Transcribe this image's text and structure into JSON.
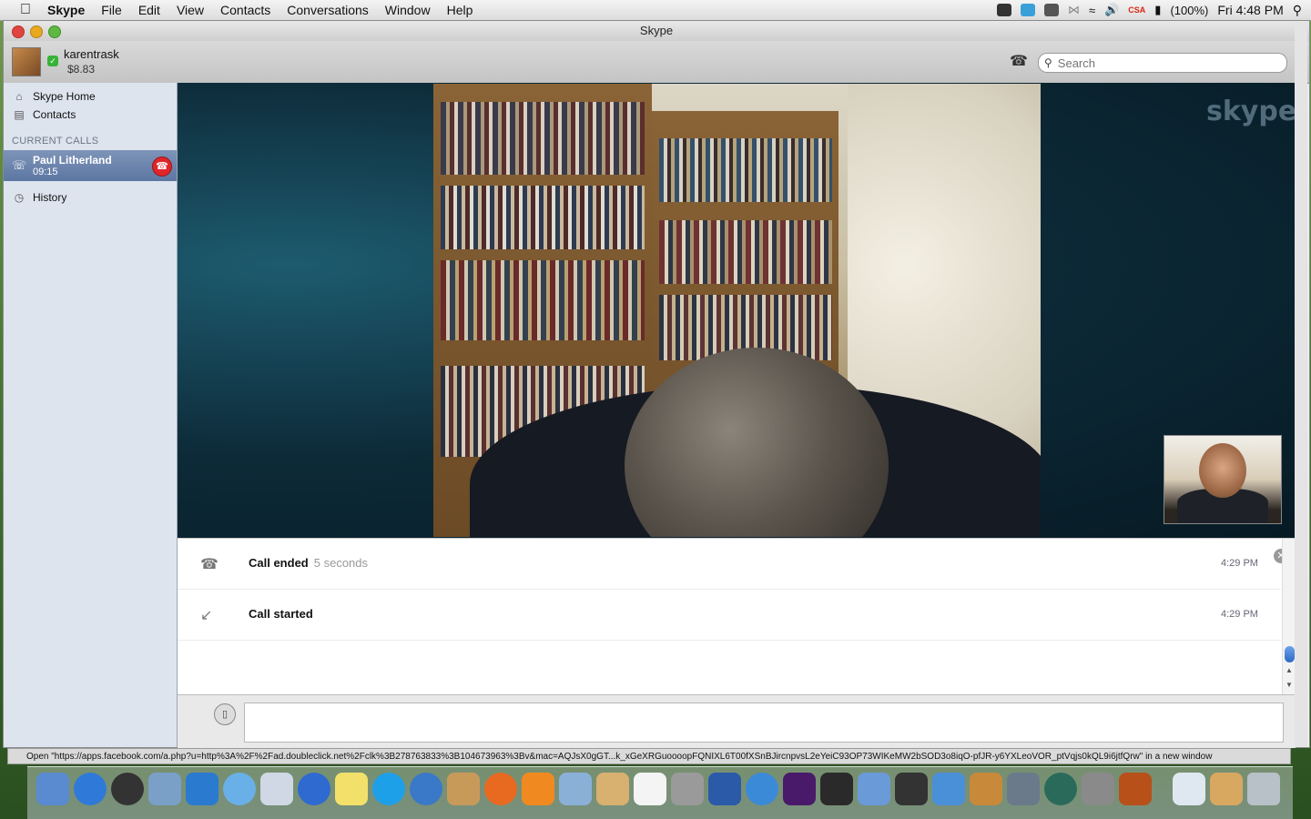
{
  "menubar": {
    "app": "Skype",
    "items": [
      "File",
      "Edit",
      "View",
      "Contacts",
      "Conversations",
      "Window",
      "Help"
    ],
    "battery": "(100%)",
    "clock": "Fri 4:48 PM",
    "flag_label": "CSA"
  },
  "window": {
    "title": "Skype"
  },
  "profile": {
    "username": "karentrask",
    "credit": "$8.83"
  },
  "search": {
    "placeholder": "Search"
  },
  "sidebar": {
    "items": [
      {
        "label": "Skype Home",
        "icon": "home-icon"
      },
      {
        "label": "Contacts",
        "icon": "contacts-icon"
      }
    ],
    "current_calls_header": "CURRENT CALLS",
    "call": {
      "name": "Paul Litherland",
      "duration": "09:15"
    },
    "history_label": "History"
  },
  "video": {
    "watermark": "skype"
  },
  "chat": {
    "events": [
      {
        "label": "Call ended",
        "detail": "5 seconds",
        "time": "4:29 PM",
        "icon": "hangup-icon"
      },
      {
        "label": "Call started",
        "detail": "",
        "time": "4:29 PM",
        "icon": "incoming-call-icon"
      }
    ]
  },
  "status_url": "Open \"https://apps.facebook.com/a.php?u=http%3A%2F%2Fad.doubleclick.net%2Fclk%3B278763833%3B104673963%3Bv&mac=AQJsX0gGT...k_xGeXRGuoooopFQNIXL6T00fXSnBJircnpvsL2eYeiC93OP73WIKeMW2bSOD3o8iqO-pfJR-y6YXLeoVOR_ptVqjs0kQL9i6jtfQrw\" in a new window",
  "colors": {
    "sidebar_bg": "#dde4ee",
    "selected_call": "#5d77a3",
    "hangup_red": "#e0262a",
    "video_bg": "#0d2a38"
  }
}
